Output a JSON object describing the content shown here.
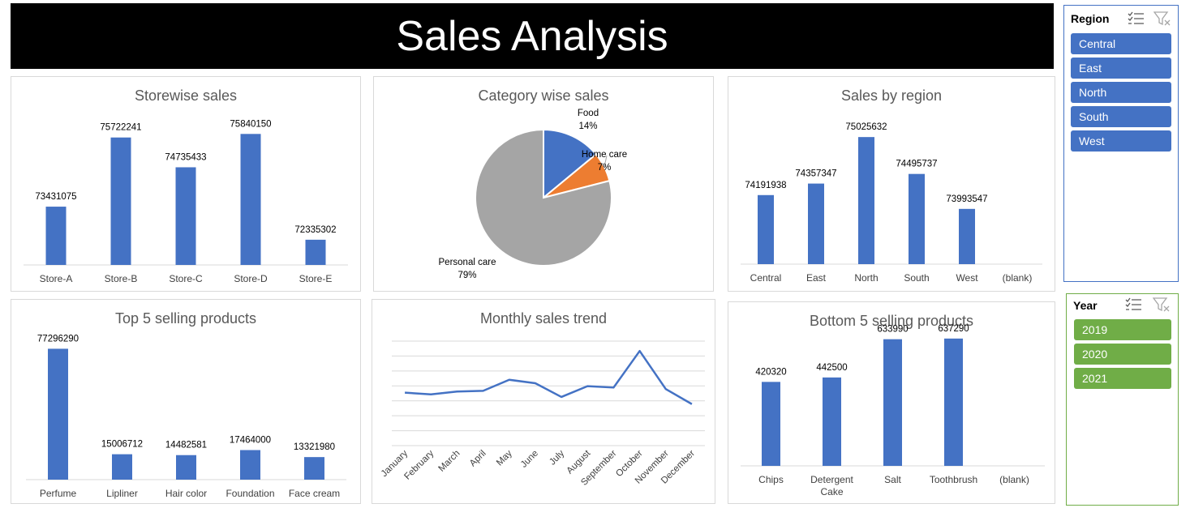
{
  "page": {
    "title": "Sales Analysis"
  },
  "colors": {
    "bar": "#4472c4",
    "food": "#4472c4",
    "home_care": "#ed7d31",
    "personal_care": "#a5a5a5",
    "region_slicer": "#4472c4",
    "year_slicer": "#70ad47"
  },
  "slicers": {
    "region": {
      "title": "Region",
      "items": [
        "Central",
        "East",
        "North",
        "South",
        "West"
      ],
      "icons": [
        "multi-select-icon",
        "clear-filter-icon"
      ]
    },
    "year": {
      "title": "Year",
      "items": [
        "2019",
        "2020",
        "2021"
      ],
      "icons": [
        "multi-select-icon",
        "clear-filter-icon"
      ]
    }
  },
  "chart_data": [
    {
      "id": "storewise",
      "type": "bar",
      "title": "Storewise sales",
      "categories": [
        "Store-A",
        "Store-B",
        "Store-C",
        "Store-D",
        "Store-E"
      ],
      "values": [
        73431075,
        75722241,
        74735433,
        75840150,
        72335302
      ],
      "ylim": [
        71500000,
        76600000
      ],
      "data_labels": true
    },
    {
      "id": "category",
      "type": "pie",
      "title": "Category wise sales",
      "slices": [
        {
          "label": "Food",
          "pct_label": "14%",
          "value": 14
        },
        {
          "label": "Home care",
          "pct_label": "7%",
          "value": 7
        },
        {
          "label": "Personal care",
          "pct_label": "79%",
          "value": 79
        }
      ]
    },
    {
      "id": "region",
      "type": "bar",
      "title": "Sales by region",
      "categories": [
        "Central",
        "East",
        "North",
        "South",
        "West",
        "(blank)"
      ],
      "values": [
        74191938,
        74357347,
        75025632,
        74495737,
        73993547,
        null
      ],
      "ylim": [
        73200000,
        75400000
      ],
      "data_labels": true
    },
    {
      "id": "top5",
      "type": "bar",
      "title": "Top 5 selling products",
      "categories": [
        "Perfume",
        "Lipliner",
        "Hair color",
        "Foundation",
        "Face cream"
      ],
      "values": [
        77296290,
        15006712,
        14482581,
        17464000,
        13321980
      ],
      "ylim": [
        0,
        100000000
      ],
      "data_labels": true
    },
    {
      "id": "monthly",
      "type": "line",
      "title": "Monthly sales trend",
      "categories": [
        "January",
        "February",
        "March",
        "April",
        "May",
        "June",
        "July",
        "August",
        "September",
        "October",
        "November",
        "December"
      ],
      "values": [
        35.5,
        34.3,
        36.2,
        36.7,
        44.1,
        41.8,
        32.6,
        39.8,
        38.9,
        63.4,
        37.9,
        27.8
      ],
      "ylim": [
        0,
        70
      ],
      "grid": true
    },
    {
      "id": "bottom5",
      "type": "bar",
      "title": "Bottom 5 selling products",
      "categories": [
        "Chips",
        "Detergent Cake",
        "Salt",
        "Toothbrush",
        "(blank)"
      ],
      "values": [
        420320,
        442500,
        633990,
        637290,
        null
      ],
      "ylim": [
        0,
        730000
      ],
      "data_labels": true
    }
  ]
}
